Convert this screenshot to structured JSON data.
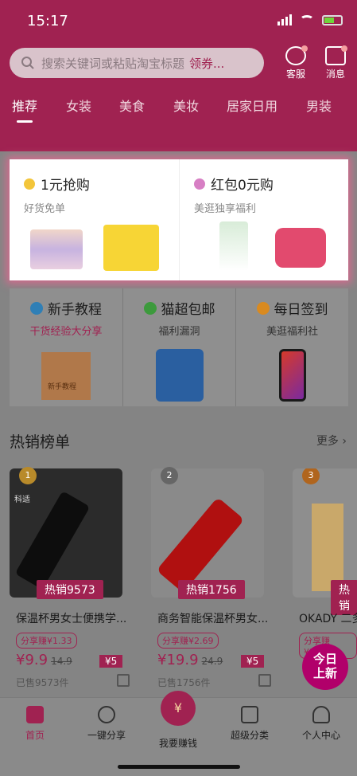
{
  "status": {
    "time": "15:17"
  },
  "search": {
    "placeholder": "搜索关键词或粘贴淘宝标题",
    "action": "领券..."
  },
  "header_icons": {
    "service": "客服",
    "message": "消息"
  },
  "tabs": [
    "推荐",
    "女装",
    "美食",
    "美妆",
    "居家日用",
    "男装"
  ],
  "promo": [
    {
      "title": "1元抢购",
      "subtitle": "好货免单"
    },
    {
      "title": "红包0元购",
      "subtitle": "美逛独享福利"
    }
  ],
  "features": [
    {
      "title": "新手教程",
      "subtitle": "干货经验大分享",
      "book_label": "新手教程"
    },
    {
      "title": "猫超包邮",
      "subtitle": "福利漏洞"
    },
    {
      "title": "每日签到",
      "subtitle": "美逛福利社"
    }
  ],
  "hot": {
    "title": "热销榜单",
    "more": "更多"
  },
  "products": [
    {
      "rank": "1",
      "brand": "科适",
      "sale_tag": "热销9573",
      "name": "保温杯男女士便携学...",
      "share": "分享赚¥1.33",
      "price": "¥9.9",
      "orig": "14.9",
      "coupon": "¥5",
      "sold": "已售9573件"
    },
    {
      "rank": "2",
      "sale_tag": "热销1756",
      "name": "商务智能保温杯男女...",
      "share": "分享赚¥2.69",
      "price": "¥19.9",
      "orig": "24.9",
      "coupon": "¥5",
      "sold": "已售1756件"
    },
    {
      "rank": "3",
      "sale_tag": "热销",
      "name": "OKADY 二多",
      "share": "分享赚¥16.0",
      "price": "",
      "orig": "",
      "coupon": "",
      "sold": ""
    }
  ],
  "float_btn": [
    "今日",
    "上新"
  ],
  "tabbar": [
    "首页",
    "一键分享",
    "我要赚钱",
    "超级分类",
    "个人中心"
  ],
  "colors": {
    "brand": "#a02251",
    "overlay": "#848484"
  }
}
